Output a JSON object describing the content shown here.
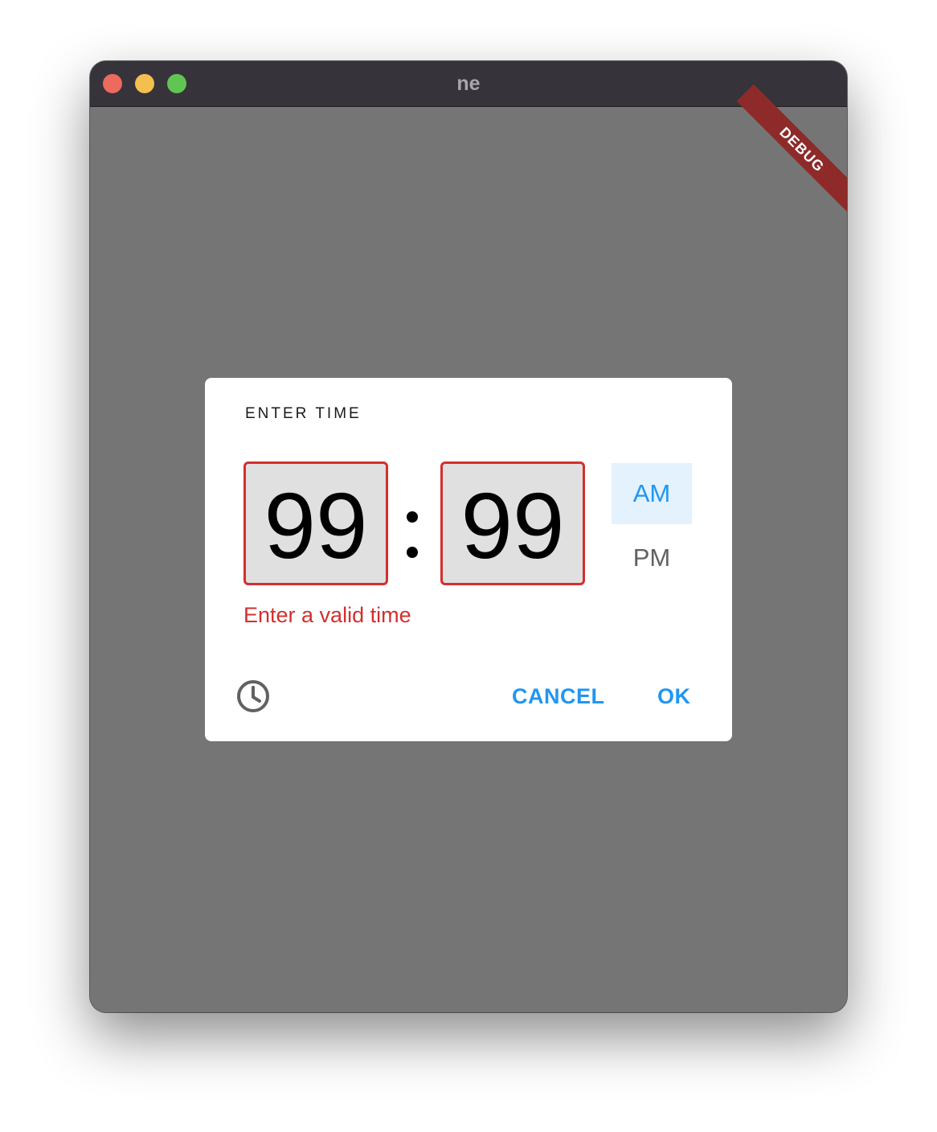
{
  "window": {
    "title": "ne"
  },
  "debug_banner": {
    "label": "DEBUG"
  },
  "dialog": {
    "title": "ENTER TIME",
    "hour_value": "99",
    "minute_value": "99",
    "period": {
      "am_label": "AM",
      "pm_label": "PM",
      "selected": "AM"
    },
    "error_message": "Enter a valid time",
    "mode_icon": "clock-icon",
    "cancel_label": "CANCEL",
    "ok_label": "OK"
  },
  "colors": {
    "accent": "#2196f3",
    "error": "#d32f2f",
    "scrim": "#757575",
    "selected_period_bg": "#e3f2fd",
    "debug_ribbon": "#8e2a2a"
  }
}
